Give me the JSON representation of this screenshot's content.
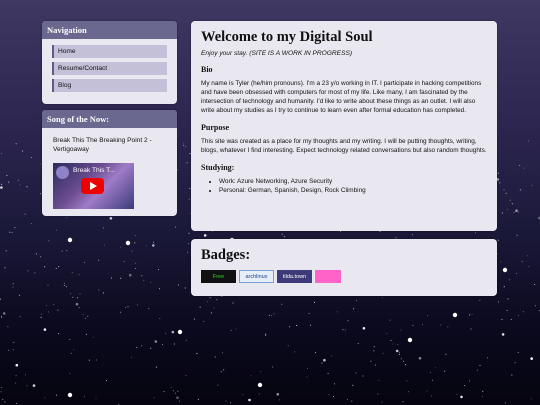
{
  "colors": {
    "panel_bg": "#e9e8f0",
    "panel_header": "#6b6890",
    "nav_item_bg": "#c3c0d8",
    "youtube_red": "#ee0000"
  },
  "nav": {
    "title": "Navigation",
    "items": [
      {
        "label": "Home"
      },
      {
        "label": "Resume/Contact"
      },
      {
        "label": "Blog"
      }
    ]
  },
  "song": {
    "title": "Song of the Now:",
    "track": "Break This The Breaking Point 2 - Vertigoaway",
    "video_title": "Break This T...",
    "video_icon": "youtube-play-icon"
  },
  "main": {
    "title": "Welcome to my Digital Soul",
    "subtitle": "Enjoy your stay. (SITE IS A WORK IN PROGRESS)",
    "sections": [
      {
        "heading": "Bio",
        "text": "My name is Tyler (he/him pronouns). I'm a 23 y/o working in IT. I participate in hacking competitions and have been obsessed with computers for most of my life. Like many, I am fascinated by the intersection of technology and humanity. I'd like to write about these things as an outlet. I will also write about my studies as I try to continue to learn even after formal education has completed."
      },
      {
        "heading": "Purpose",
        "text": "This site was created as a place for my thoughts and my writing. I will be putting thoughts, writing, blogs, whatever I find interesting. Expect technology related conversations but also random thoughts."
      }
    ],
    "studying": {
      "heading": "Studying:",
      "items": [
        "Work: Azure Networking, Azure Security",
        "Personal: German, Spanish, Design, Rock Climbing"
      ]
    }
  },
  "badges": {
    "title": "Badges:",
    "items": [
      {
        "label": "Free"
      },
      {
        "label": "archlinux"
      },
      {
        "label": "tilda.town"
      },
      {
        "label": ""
      }
    ]
  }
}
